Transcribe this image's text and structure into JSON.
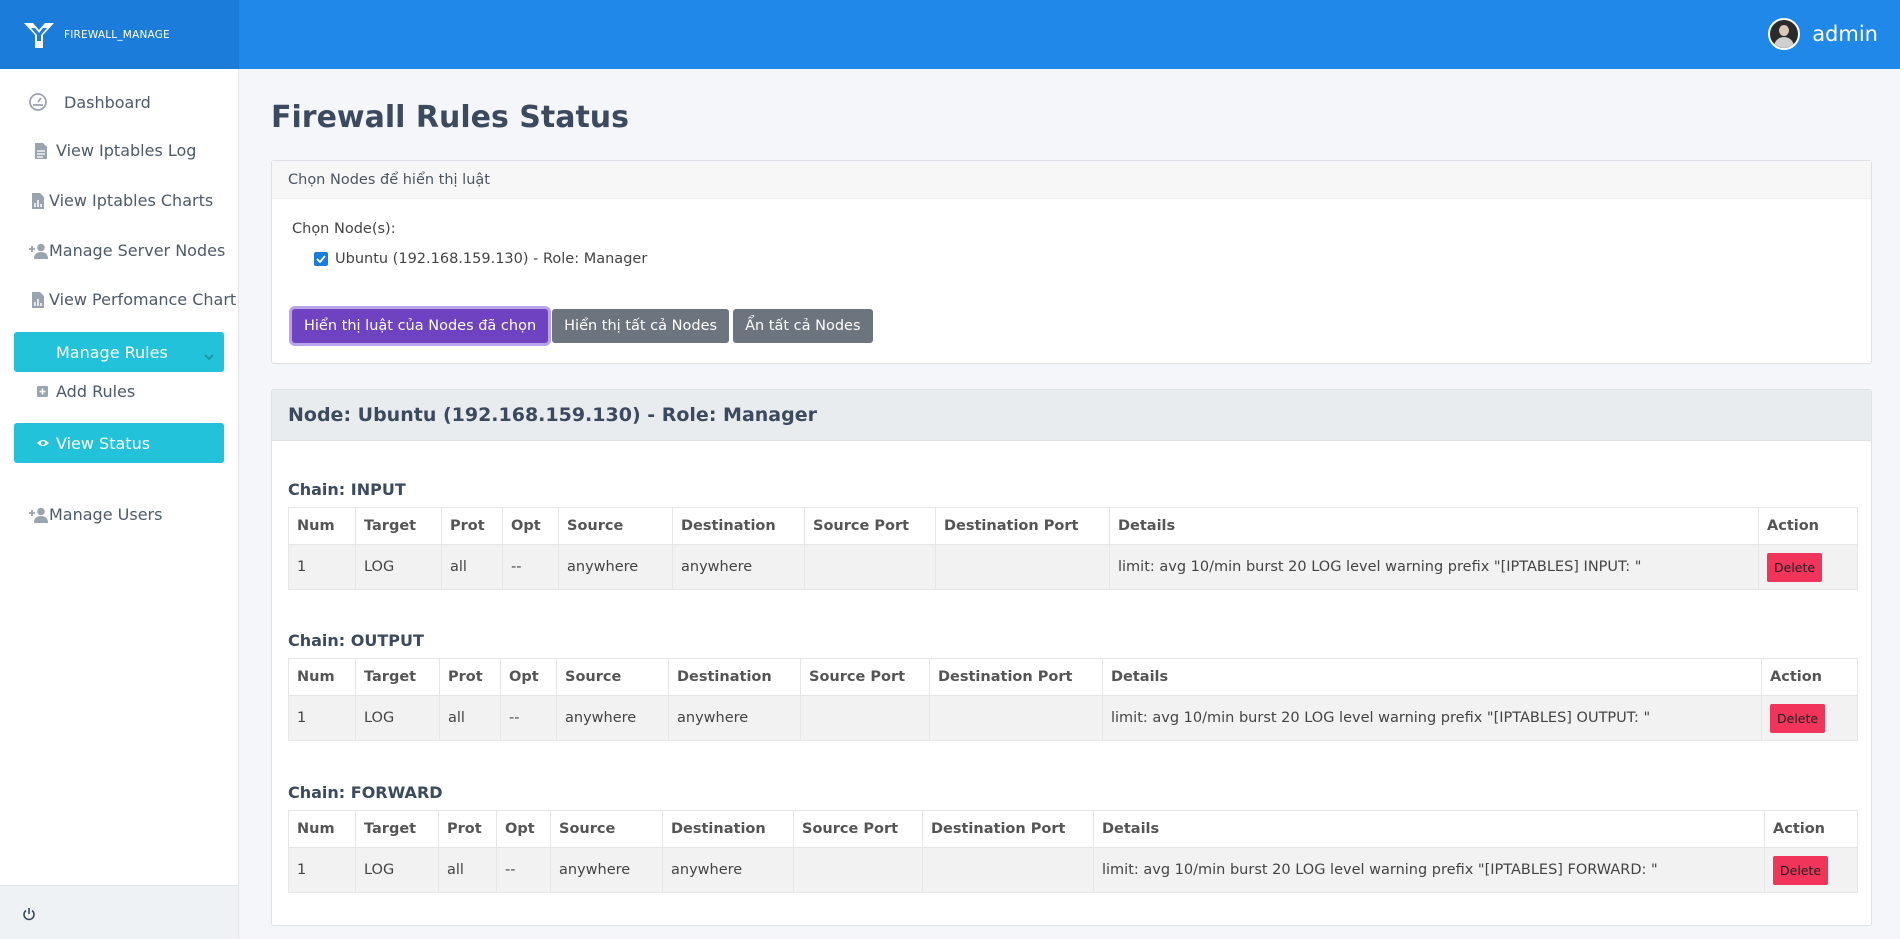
{
  "brand": {
    "name": "FIREWALL_MANAGE"
  },
  "user": {
    "name": "admin"
  },
  "sidebar": {
    "items": [
      {
        "label": "Dashboard",
        "icon": "dashboard-icon"
      },
      {
        "label": "View Iptables Log",
        "icon": "file-icon"
      },
      {
        "label": "View Iptables Charts",
        "icon": "chart-file-icon"
      },
      {
        "label": "Manage Server Nodes",
        "icon": "user-plus-icon"
      },
      {
        "label": "View Perfomance Chart",
        "icon": "chart-file-icon"
      },
      {
        "label": "Manage Rules",
        "icon": "chevron-down-icon"
      },
      {
        "label": "Add Rules",
        "icon": "plus-square-icon"
      },
      {
        "label": "View Status",
        "icon": "eye-icon"
      },
      {
        "label": "Manage Users",
        "icon": "user-plus-icon"
      }
    ]
  },
  "page": {
    "title": "Firewall Rules Status"
  },
  "node_selector": {
    "header": "Chọn Nodes để hiển thị luật",
    "label": "Chọn Node(s):",
    "nodes": [
      {
        "label": "Ubuntu (192.168.159.130) - Role: Manager",
        "checked": true
      }
    ],
    "buttons": {
      "show_selected": "Hiển thị luật của Nodes đã chọn",
      "show_all": "Hiển thị tất cả Nodes",
      "hide_all": "Ẩn tất cả Nodes"
    }
  },
  "node_panel": {
    "title": "Node: Ubuntu (192.168.159.130) - Role: Manager",
    "columns": [
      "Num",
      "Target",
      "Prot",
      "Opt",
      "Source",
      "Destination",
      "Source Port",
      "Destination Port",
      "Details",
      "Action"
    ],
    "chains": [
      {
        "title": "Chain: INPUT",
        "rows": [
          {
            "num": "1",
            "target": "LOG",
            "prot": "all",
            "opt": "--",
            "source": "anywhere",
            "destination": "anywhere",
            "source_port": "",
            "destination_port": "",
            "details": "limit: avg 10/min burst 20 LOG level warning prefix \"[IPTABLES] INPUT: \"",
            "action": "Delete"
          }
        ]
      },
      {
        "title": "Chain: OUTPUT",
        "rows": [
          {
            "num": "1",
            "target": "LOG",
            "prot": "all",
            "opt": "--",
            "source": "anywhere",
            "destination": "anywhere",
            "source_port": "",
            "destination_port": "",
            "details": "limit: avg 10/min burst 20 LOG level warning prefix \"[IPTABLES] OUTPUT: \"",
            "action": "Delete"
          }
        ]
      },
      {
        "title": "Chain: FORWARD",
        "rows": [
          {
            "num": "1",
            "target": "LOG",
            "prot": "all",
            "opt": "--",
            "source": "anywhere",
            "destination": "anywhere",
            "source_port": "",
            "destination_port": "",
            "details": "limit: avg 10/min burst 20 LOG level warning prefix \"[IPTABLES] FORWARD: \"",
            "action": "Delete"
          }
        ]
      }
    ]
  },
  "colors": {
    "topbar": "#2088e8",
    "brand_bg": "#1b7cd9",
    "active_nav": "#21c2da",
    "primary_button": "#6f42c1",
    "secondary_button": "#6c757d",
    "delete_button": "#f0345a"
  }
}
